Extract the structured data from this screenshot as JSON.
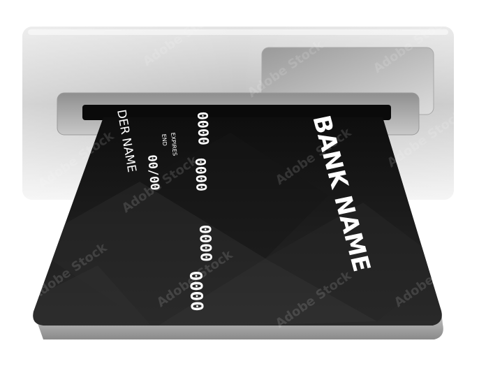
{
  "card": {
    "bank_name": "BANK NAME",
    "holder_label": "DER NAME",
    "number_groups": [
      "0000",
      "0000",
      "0000",
      "0000"
    ],
    "expires_label": "EXPIRES",
    "end_label": "END",
    "expiry_value": "00/00"
  },
  "watermark": {
    "text": "Adobe Stock"
  },
  "colors": {
    "background": "#ffffff",
    "machine_body": "#c9c9c9",
    "card": "#1a1a1a",
    "slot": "#0a0a0a",
    "card_text": "#ffffff"
  }
}
